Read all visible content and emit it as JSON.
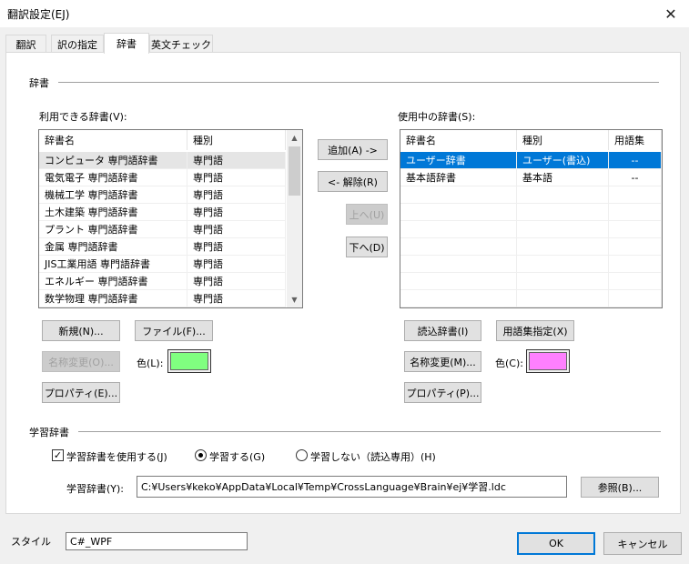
{
  "window": {
    "title": "翻訳設定(EJ)"
  },
  "tabs": [
    {
      "label": "翻訳"
    },
    {
      "label": "訳の指定"
    },
    {
      "label": "辞書"
    },
    {
      "label": "英文チェック"
    }
  ],
  "dictionary_group": {
    "title": "辞書",
    "available": {
      "label": "利用できる辞書(V):",
      "columns": [
        "辞書名",
        "種別"
      ],
      "rows": [
        [
          "コンピュータ 専門語辞書",
          "専門語"
        ],
        [
          "電気電子 専門語辞書",
          "専門語"
        ],
        [
          "機械工学 専門語辞書",
          "専門語"
        ],
        [
          "土木建築 専門語辞書",
          "専門語"
        ],
        [
          "プラント 専門語辞書",
          "専門語"
        ],
        [
          "金属 専門語辞書",
          "専門語"
        ],
        [
          "JIS工業用語 専門語辞書",
          "専門語"
        ],
        [
          "エネルギー 専門語辞書",
          "専門語"
        ],
        [
          "数学物理 専門語辞書",
          "専門語"
        ]
      ]
    },
    "in_use": {
      "label": "使用中の辞書(S):",
      "columns": [
        "辞書名",
        "種別",
        "用語集"
      ],
      "rows": [
        [
          "ユーザー辞書",
          "ユーザー(書込)",
          "--"
        ],
        [
          "基本語辞書",
          "基本語",
          "--"
        ]
      ]
    },
    "buttons": {
      "add": "追加(A) ->",
      "remove": "<- 解除(R)",
      "up": "上へ(U)",
      "down": "下へ(D)",
      "new": "新規(N)...",
      "file": "ファイル(F)...",
      "rename_left": "名称変更(O)...",
      "properties_left": "プロパティ(E)...",
      "read_dict": "読込辞書(I)",
      "glossary": "用語集指定(X)",
      "rename_right": "名称変更(M)...",
      "properties_right": "プロパティ(P)..."
    },
    "color_left": {
      "label": "色(L):",
      "value": "#80ff80"
    },
    "color_right": {
      "label": "色(C):",
      "value": "#ff80ff"
    }
  },
  "learning_group": {
    "title": "学習辞書",
    "use_checkbox": {
      "label": "学習辞書を使用する(J)",
      "checked": true
    },
    "radio_learn": {
      "label": "学習する(G)",
      "selected": true
    },
    "radio_nolearn": {
      "label": "学習しない（読込専用）(H)",
      "selected": false
    },
    "path_label": "学習辞書(Y):",
    "path_value": "C:¥Users¥keko¥AppData¥Local¥Temp¥CrossLanguage¥Brain¥ej¥学習.ldc",
    "browse": "参照(B)..."
  },
  "footer": {
    "style_label": "スタイル",
    "style_value": "C#_WPF",
    "ok": "OK",
    "cancel": "キャンセル"
  },
  "colors": {
    "selection": "#0078d7",
    "default_button_border": "#0078d7"
  },
  "icons": {
    "close": "close-icon",
    "scroll_up": "chevron-up-icon",
    "scroll_down": "chevron-down-icon",
    "check": "check-icon"
  }
}
